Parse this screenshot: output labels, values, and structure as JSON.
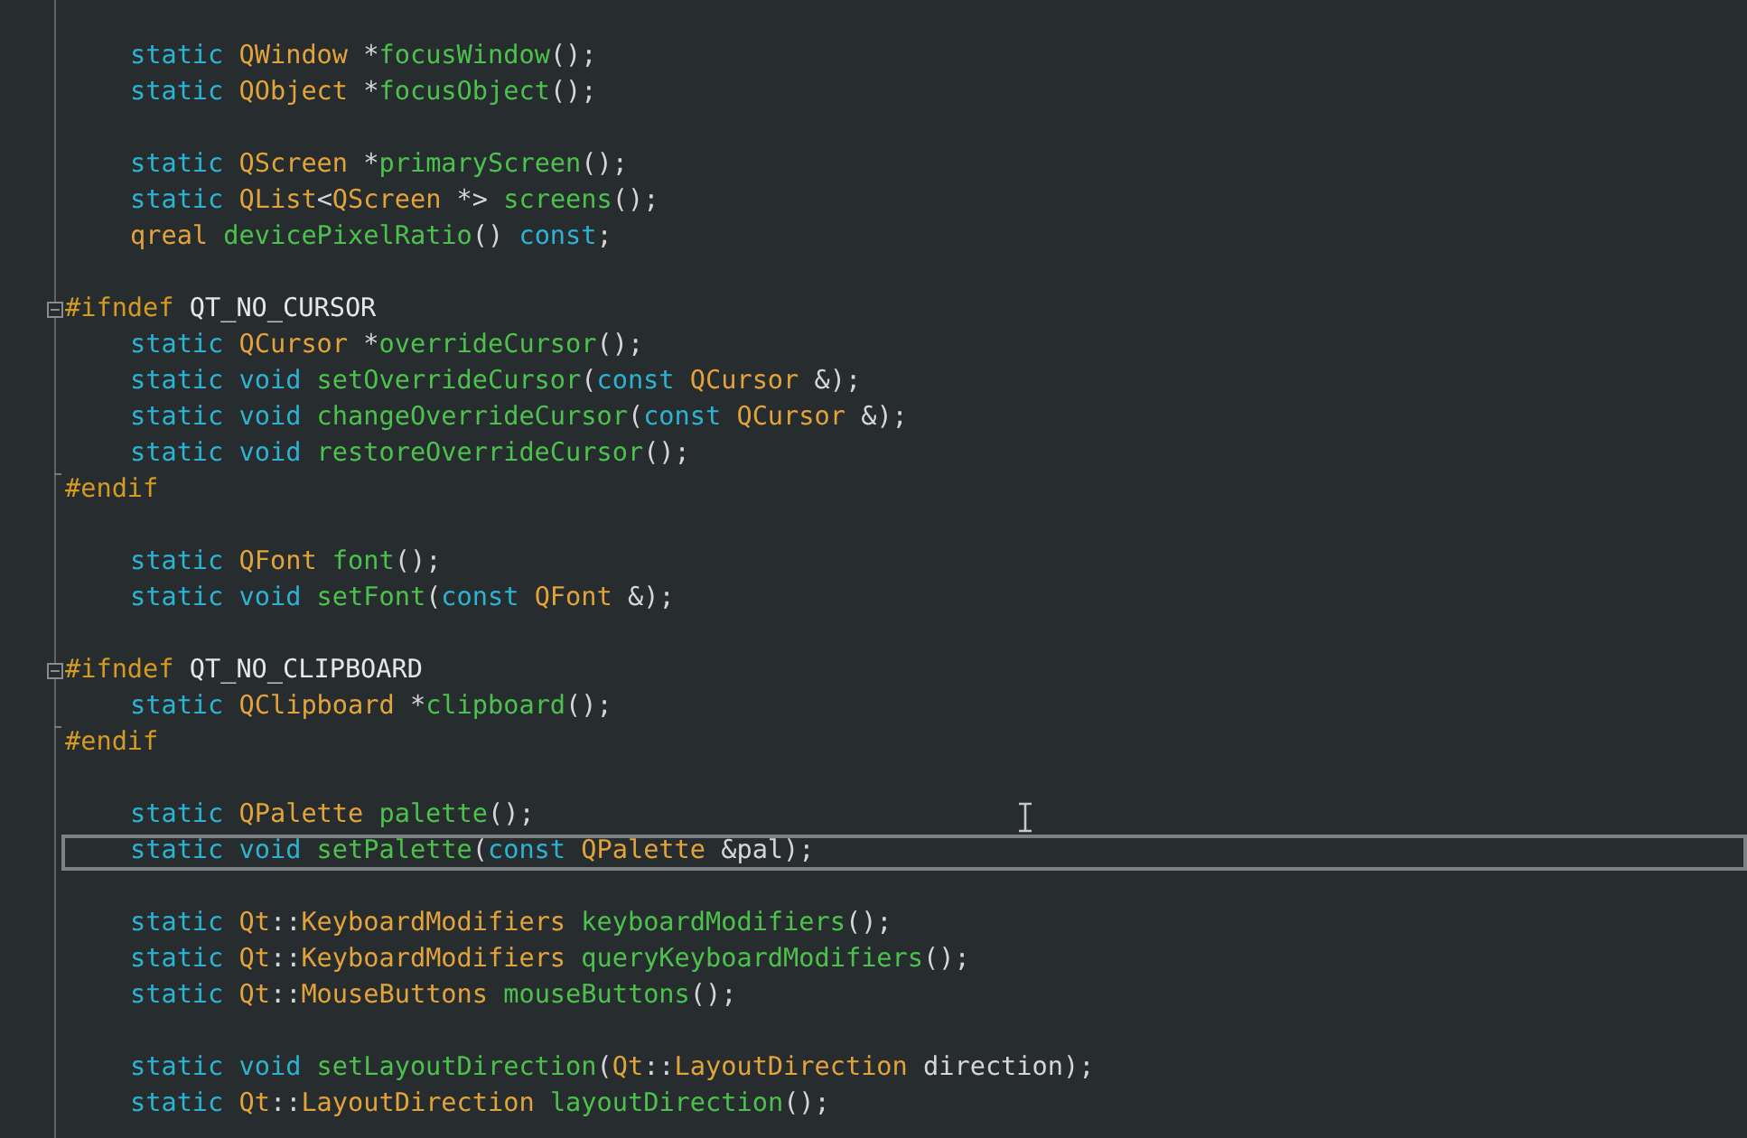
{
  "editor": {
    "blocks": [
      {
        "lines": [
          {
            "indented": true,
            "tokens": [
              {
                "kind": "keyword",
                "text": "static "
              },
              {
                "kind": "type",
                "text": "QWindow "
              },
              {
                "kind": "plain",
                "text": "*"
              },
              {
                "kind": "function",
                "text": "focusWindow"
              },
              {
                "kind": "plain",
                "text": "();"
              }
            ]
          },
          {
            "indented": true,
            "tokens": [
              {
                "kind": "keyword",
                "text": "static "
              },
              {
                "kind": "type",
                "text": "QObject "
              },
              {
                "kind": "plain",
                "text": "*"
              },
              {
                "kind": "function",
                "text": "focusObject"
              },
              {
                "kind": "plain",
                "text": "();"
              }
            ]
          }
        ]
      },
      {
        "lines": [
          {
            "indented": true,
            "tokens": [
              {
                "kind": "keyword",
                "text": "static "
              },
              {
                "kind": "type",
                "text": "QScreen "
              },
              {
                "kind": "plain",
                "text": "*"
              },
              {
                "kind": "function",
                "text": "primaryScreen"
              },
              {
                "kind": "plain",
                "text": "();"
              }
            ]
          },
          {
            "indented": true,
            "tokens": [
              {
                "kind": "keyword",
                "text": "static "
              },
              {
                "kind": "type",
                "text": "QList"
              },
              {
                "kind": "plain",
                "text": "<"
              },
              {
                "kind": "type",
                "text": "QScreen "
              },
              {
                "kind": "plain",
                "text": "*> "
              },
              {
                "kind": "function",
                "text": "screens"
              },
              {
                "kind": "plain",
                "text": "();"
              }
            ]
          },
          {
            "indented": true,
            "tokens": [
              {
                "kind": "type",
                "text": "qreal "
              },
              {
                "kind": "function",
                "text": "devicePixelRatio"
              },
              {
                "kind": "plain",
                "text": "() "
              },
              {
                "kind": "keyword",
                "text": "const"
              },
              {
                "kind": "plain",
                "text": ";"
              }
            ]
          }
        ]
      },
      {
        "lines": [
          {
            "indented": false,
            "fold_start": true,
            "fold_end": false,
            "tokens": [
              {
                "kind": "directive",
                "text": "#ifndef "
              },
              {
                "kind": "macro",
                "text": "QT_NO_CURSOR"
              }
            ]
          },
          {
            "indented": true,
            "tokens": [
              {
                "kind": "keyword",
                "text": "static "
              },
              {
                "kind": "type",
                "text": "QCursor "
              },
              {
                "kind": "plain",
                "text": "*"
              },
              {
                "kind": "function",
                "text": "overrideCursor"
              },
              {
                "kind": "plain",
                "text": "();"
              }
            ]
          },
          {
            "indented": true,
            "tokens": [
              {
                "kind": "keyword",
                "text": "static void "
              },
              {
                "kind": "function",
                "text": "setOverrideCursor"
              },
              {
                "kind": "plain",
                "text": "("
              },
              {
                "kind": "keyword",
                "text": "const "
              },
              {
                "kind": "type",
                "text": "QCursor "
              },
              {
                "kind": "plain",
                "text": "&);"
              }
            ]
          },
          {
            "indented": true,
            "tokens": [
              {
                "kind": "keyword",
                "text": "static void "
              },
              {
                "kind": "function",
                "text": "changeOverrideCursor"
              },
              {
                "kind": "plain",
                "text": "("
              },
              {
                "kind": "keyword",
                "text": "const "
              },
              {
                "kind": "type",
                "text": "QCursor "
              },
              {
                "kind": "plain",
                "text": "&);"
              }
            ]
          },
          {
            "indented": true,
            "fold_start": false,
            "fold_end": true,
            "tokens": [
              {
                "kind": "keyword",
                "text": "static void "
              },
              {
                "kind": "function",
                "text": "restoreOverrideCursor"
              },
              {
                "kind": "plain",
                "text": "();"
              }
            ]
          },
          {
            "indented": false,
            "tokens": [
              {
                "kind": "directive",
                "text": "#endif"
              }
            ]
          }
        ]
      },
      {
        "lines": [
          {
            "indented": true,
            "tokens": [
              {
                "kind": "keyword",
                "text": "static "
              },
              {
                "kind": "type",
                "text": "QFont "
              },
              {
                "kind": "function",
                "text": "font"
              },
              {
                "kind": "plain",
                "text": "();"
              }
            ]
          },
          {
            "indented": true,
            "tokens": [
              {
                "kind": "keyword",
                "text": "static void "
              },
              {
                "kind": "function",
                "text": "setFont"
              },
              {
                "kind": "plain",
                "text": "("
              },
              {
                "kind": "keyword",
                "text": "const "
              },
              {
                "kind": "type",
                "text": "QFont "
              },
              {
                "kind": "plain",
                "text": "&);"
              }
            ]
          }
        ]
      },
      {
        "lines": [
          {
            "indented": false,
            "fold_start": true,
            "fold_end": false,
            "tokens": [
              {
                "kind": "directive",
                "text": "#ifndef "
              },
              {
                "kind": "macro",
                "text": "QT_NO_CLIPBOARD"
              }
            ]
          },
          {
            "indented": true,
            "fold_start": false,
            "fold_end": true,
            "tokens": [
              {
                "kind": "keyword",
                "text": "static "
              },
              {
                "kind": "type",
                "text": "QClipboard "
              },
              {
                "kind": "plain",
                "text": "*"
              },
              {
                "kind": "function",
                "text": "clipboard"
              },
              {
                "kind": "plain",
                "text": "();"
              }
            ]
          },
          {
            "indented": false,
            "tokens": [
              {
                "kind": "directive",
                "text": "#endif"
              }
            ]
          }
        ]
      },
      {
        "lines": [
          {
            "indented": true,
            "tokens": [
              {
                "kind": "keyword",
                "text": "static "
              },
              {
                "kind": "type",
                "text": "QPalette "
              },
              {
                "kind": "function",
                "text": "palette"
              },
              {
                "kind": "plain",
                "text": "();"
              }
            ]
          },
          {
            "indented": true,
            "current": true,
            "tokens": [
              {
                "kind": "keyword",
                "text": "static void "
              },
              {
                "kind": "function",
                "text": "setPalette"
              },
              {
                "kind": "plain",
                "text": "("
              },
              {
                "kind": "keyword",
                "text": "const "
              },
              {
                "kind": "type",
                "text": "QPalette "
              },
              {
                "kind": "plain",
                "text": "&pal);"
              }
            ]
          }
        ]
      },
      {
        "lines": [
          {
            "indented": true,
            "tokens": [
              {
                "kind": "keyword",
                "text": "static "
              },
              {
                "kind": "type",
                "text": "Qt"
              },
              {
                "kind": "plain",
                "text": "::"
              },
              {
                "kind": "type",
                "text": "KeyboardModifiers "
              },
              {
                "kind": "function",
                "text": "keyboardModifiers"
              },
              {
                "kind": "plain",
                "text": "();"
              }
            ]
          },
          {
            "indented": true,
            "tokens": [
              {
                "kind": "keyword",
                "text": "static "
              },
              {
                "kind": "type",
                "text": "Qt"
              },
              {
                "kind": "plain",
                "text": "::"
              },
              {
                "kind": "type",
                "text": "KeyboardModifiers "
              },
              {
                "kind": "function",
                "text": "queryKeyboardModifiers"
              },
              {
                "kind": "plain",
                "text": "();"
              }
            ]
          },
          {
            "indented": true,
            "tokens": [
              {
                "kind": "keyword",
                "text": "static "
              },
              {
                "kind": "type",
                "text": "Qt"
              },
              {
                "kind": "plain",
                "text": "::"
              },
              {
                "kind": "type",
                "text": "MouseButtons "
              },
              {
                "kind": "function",
                "text": "mouseButtons"
              },
              {
                "kind": "plain",
                "text": "();"
              }
            ]
          }
        ]
      },
      {
        "lines": [
          {
            "indented": true,
            "tokens": [
              {
                "kind": "keyword",
                "text": "static void "
              },
              {
                "kind": "function",
                "text": "setLayoutDirection"
              },
              {
                "kind": "plain",
                "text": "("
              },
              {
                "kind": "type",
                "text": "Qt"
              },
              {
                "kind": "plain",
                "text": "::"
              },
              {
                "kind": "type",
                "text": "LayoutDirection "
              },
              {
                "kind": "plain",
                "text": "direction);"
              }
            ]
          },
          {
            "indented": true,
            "tokens": [
              {
                "kind": "keyword",
                "text": "static "
              },
              {
                "kind": "type",
                "text": "Qt"
              },
              {
                "kind": "plain",
                "text": "::"
              },
              {
                "kind": "type",
                "text": "LayoutDirection "
              },
              {
                "kind": "function",
                "text": "layoutDirection"
              },
              {
                "kind": "plain",
                "text": "();"
              }
            ]
          }
        ]
      }
    ]
  }
}
